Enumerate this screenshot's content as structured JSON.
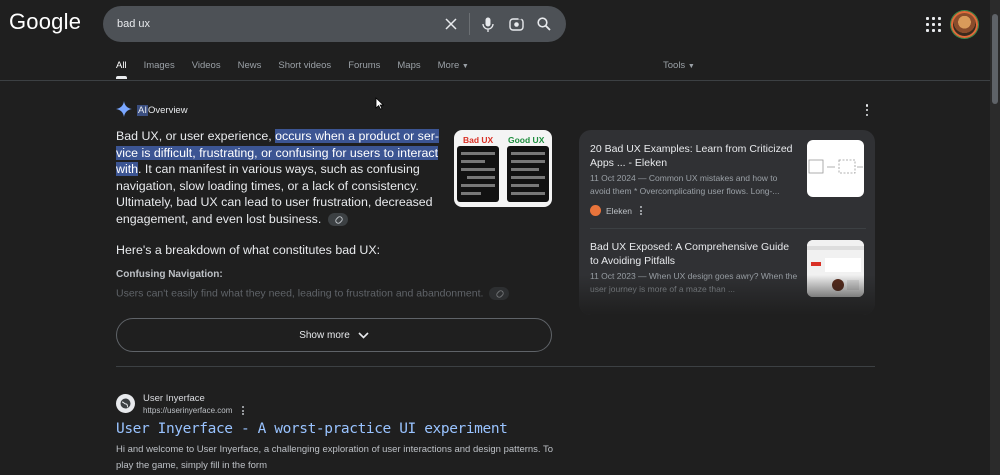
{
  "logo": "Google",
  "search": {
    "query": "bad ux"
  },
  "tabs": [
    "All",
    "Images",
    "Videos",
    "News",
    "Short videos",
    "Forums",
    "Maps",
    "More"
  ],
  "tools_label": "Tools",
  "ai_overview": {
    "label_ai": "AI",
    "label_rest": " Overview",
    "para_start": "Bad UX, or user experience, ",
    "para_selected": "occurs when a product or ser­vice is difficult, frustrating, or confusing for users to interact with",
    "para_end": ". It can manifest in various ways, such as confusing navig­ation, slow loading times, or a lack of consistency. Ultimately, bad UX can lead to user frustration, decreased engagement, and even lost business.",
    "image_left_label": "Bad UX",
    "image_right_label": "Good UX",
    "breakdown": "Here's a breakdown of what constitutes bad UX:",
    "subheading": "Confusing Navigation:",
    "faded_text": "Users can't easily find what they need, leading to frustration and abandonment.",
    "show_more": "Show more"
  },
  "sources": [
    {
      "title": "20 Bad UX Examples: Learn from Criticized Apps ... - Eleken",
      "snippet": "11 Oct 2024 — Common UX mistakes and how to avoid them * Overcomplicating user flows. Long-...",
      "site": "Eleken"
    },
    {
      "title": "Bad UX Exposed: A Comprehensive Guide to Avoiding Pitfalls",
      "snippet": "11 Oct 2023 — When UX design goes awry? When the user journey is more of a maze than ...",
      "site": ""
    }
  ],
  "result": {
    "site_name": "User Inyerface",
    "url": "https://userinyerface.com",
    "title": "User Inyerface - A worst-practice UI experiment",
    "snippet": "Hi and welcome to User Inyerface, a challenging exploration of user interactions and design patterns. To play the game, simply fill in the form"
  },
  "colors": {
    "background": "#1f1f1f",
    "link": "#99c3ff",
    "selection": "#3c5593"
  }
}
